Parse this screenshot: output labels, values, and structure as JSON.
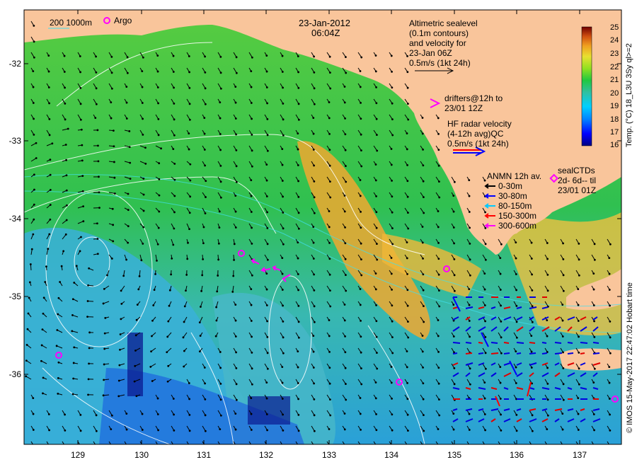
{
  "date": "23-Jan-2012",
  "time": "06:04Z",
  "scale_text": "200  1000m",
  "argo_label": "Argo",
  "altimetry_lines": [
    "Altimetric sealevel",
    "(0.1m contours)",
    "and velocity for",
    "23-Jan 06Z",
    "0.5m/s (1kt 24h)"
  ],
  "drifters_lines": [
    "drifters@12h to",
    "23/01 12Z"
  ],
  "hf_lines": [
    "HF radar velocity",
    "(4-12h avg)QC",
    "0.5m/s (1kt 24h)"
  ],
  "anmn_title": "ANMN 12h av.",
  "anmn_items": [
    {
      "label": "0-30m",
      "color": "#000000"
    },
    {
      "label": "30-80m",
      "color": "#0000ff"
    },
    {
      "label": "80-150m",
      "color": "#00c8ff"
    },
    {
      "label": "150-300m",
      "color": "#ff0000"
    },
    {
      "label": "300-600m",
      "color": "#ff00ff"
    }
  ],
  "sealctd_lines": [
    "sealCTDs",
    "2d- 6d-- til",
    "23/01 01Z"
  ],
  "colorbar": {
    "title": "Temp. (°C) 18_L3U 3Sy ql>=2",
    "ticks": [
      25,
      24,
      23,
      22,
      21,
      20,
      19,
      18,
      17,
      16
    ],
    "colors": [
      "#000080",
      "#0000ff",
      "#0080ff",
      "#00d0ff",
      "#40c0a0",
      "#20c840",
      "#80e020",
      "#e8e030",
      "#f0a020",
      "#e06010",
      "#c02000",
      "#600000"
    ]
  },
  "credit": "© IMOS 15-May-2017 22:47:02 Hobart time",
  "y_ticks": [
    "-32",
    "-33",
    "-34",
    "-35",
    "-36"
  ],
  "x_ticks": [
    "129",
    "130",
    "131",
    "132",
    "133",
    "134",
    "135",
    "136",
    "137"
  ],
  "colors": {
    "land": "#f9c59b",
    "ocean_mid": "#40c850",
    "ocean_cool": "#40b8d0",
    "ocean_warm": "#f0b020"
  }
}
